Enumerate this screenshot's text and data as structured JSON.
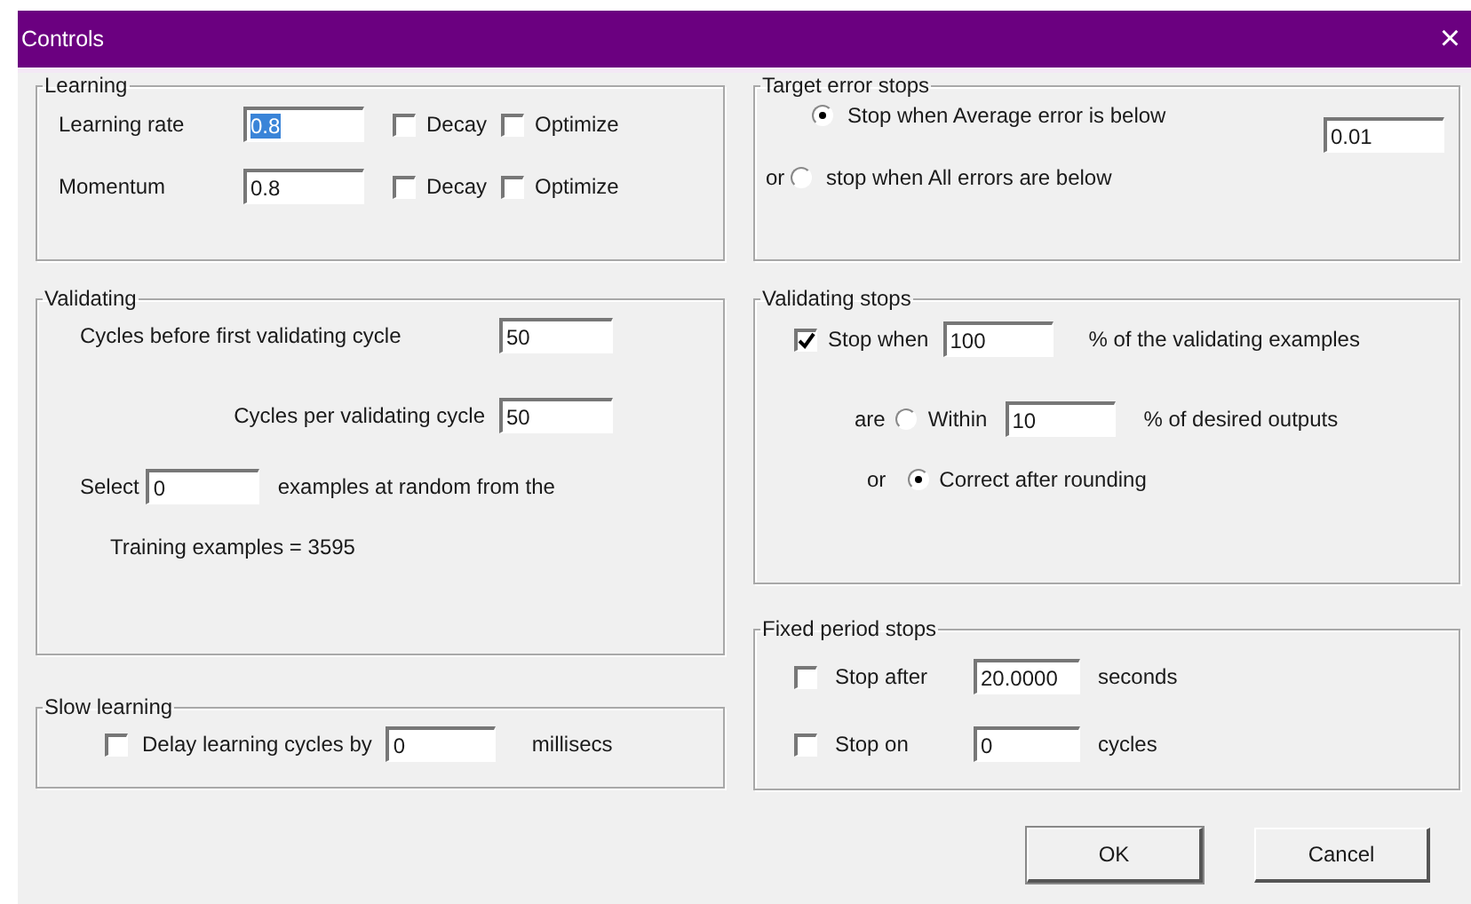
{
  "window": {
    "title": "Controls",
    "close": "×"
  },
  "learning": {
    "title": "Learning",
    "rows": [
      {
        "label": "Learning rate",
        "value": "0.8",
        "highlighted": true,
        "options": [
          {
            "label": "Decay",
            "checked": false
          },
          {
            "label": "Optimize",
            "checked": false
          }
        ]
      },
      {
        "label": "Momentum",
        "value": "0.8",
        "highlighted": false,
        "options": [
          {
            "label": "Decay",
            "checked": false
          },
          {
            "label": "Optimize",
            "checked": false
          }
        ]
      }
    ]
  },
  "validating": {
    "title": "Validating",
    "first_label": "Cycles before first validating cycle",
    "first_value": "50",
    "per_label": "Cycles per validating cycle",
    "per_value": "50",
    "select_prefix": "Select",
    "select_value": "0",
    "select_suffix": "examples at random from the",
    "training": "Training examples = 3595"
  },
  "slow_learning": {
    "title": "Slow learning",
    "checked": false,
    "label": "Delay learning cycles by",
    "value": "0",
    "unit": "millisecs"
  },
  "target_error": {
    "title": "Target error stops",
    "options": [
      {
        "label": "Stop when Average error is below",
        "selected": true
      },
      {
        "prefix": "or",
        "label": "stop when All errors are below",
        "selected": false
      }
    ],
    "value": "0.01"
  },
  "validating_stops": {
    "title": "Validating stops",
    "checked": true,
    "label": "Stop when",
    "value": "100",
    "suffix": "% of the validating examples",
    "options": [
      {
        "prefix": "are",
        "label": "Within",
        "selected": false,
        "value": "10",
        "suffix": "% of desired outputs"
      },
      {
        "prefix": "or",
        "label": "Correct after rounding",
        "selected": true
      }
    ]
  },
  "fixed_period": {
    "title": "Fixed period stops",
    "rows": [
      {
        "label": "Stop after",
        "checked": false,
        "value": "20.0000",
        "unit": "seconds"
      },
      {
        "label": "Stop on",
        "checked": false,
        "value": "0",
        "unit": "cycles"
      }
    ]
  },
  "buttons": [
    {
      "label": "OK",
      "default": true
    },
    {
      "label": "Cancel",
      "default": false
    }
  ]
}
